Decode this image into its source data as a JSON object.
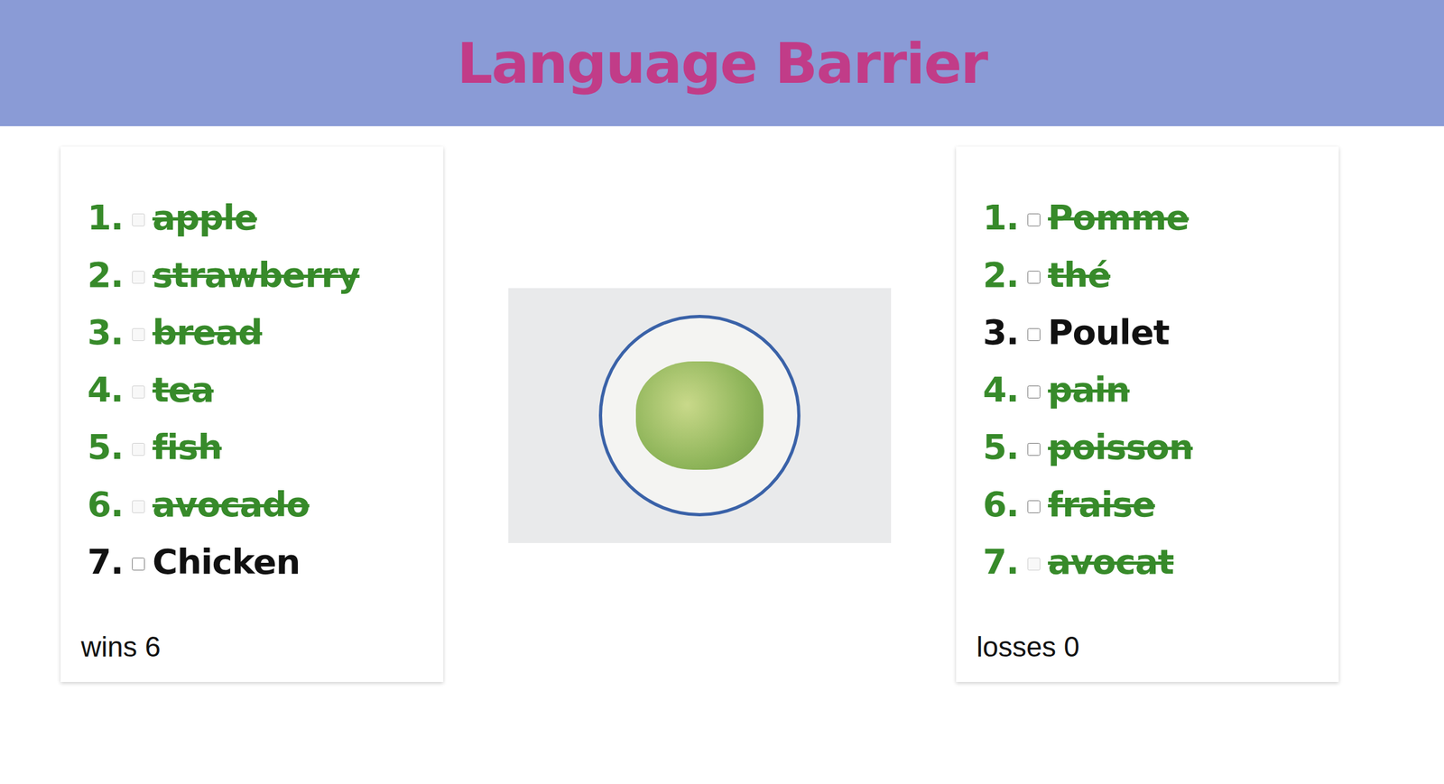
{
  "header": {
    "title": "Language Barrier"
  },
  "english": {
    "items": [
      {
        "number": "1.",
        "label": "apple",
        "done": true,
        "checked": false,
        "disabled": true
      },
      {
        "number": "2.",
        "label": "strawberry",
        "done": true,
        "checked": false,
        "disabled": true
      },
      {
        "number": "3.",
        "label": "bread",
        "done": true,
        "checked": false,
        "disabled": true
      },
      {
        "number": "4.",
        "label": "tea",
        "done": true,
        "checked": false,
        "disabled": true
      },
      {
        "number": "5.",
        "label": "fish",
        "done": true,
        "checked": false,
        "disabled": true
      },
      {
        "number": "6.",
        "label": "avocado",
        "done": true,
        "checked": false,
        "disabled": true
      },
      {
        "number": "7.",
        "label": "Chicken",
        "done": false,
        "checked": false,
        "disabled": false
      }
    ],
    "score": {
      "label": "wins",
      "value": "6"
    }
  },
  "french": {
    "items": [
      {
        "number": "1.",
        "label": "Pomme",
        "done": true,
        "checked": false,
        "disabled": false
      },
      {
        "number": "2.",
        "label": "thé",
        "done": true,
        "checked": false,
        "disabled": false
      },
      {
        "number": "3.",
        "label": "Poulet",
        "done": false,
        "checked": false,
        "disabled": false
      },
      {
        "number": "4.",
        "label": "pain",
        "done": true,
        "checked": false,
        "disabled": false
      },
      {
        "number": "5.",
        "label": "poisson",
        "done": true,
        "checked": false,
        "disabled": false
      },
      {
        "number": "6.",
        "label": "fraise",
        "done": true,
        "checked": false,
        "disabled": false
      },
      {
        "number": "7.",
        "label": "avocat",
        "done": true,
        "checked": false,
        "disabled": true
      }
    ],
    "score": {
      "label": "losses",
      "value": "0"
    }
  }
}
